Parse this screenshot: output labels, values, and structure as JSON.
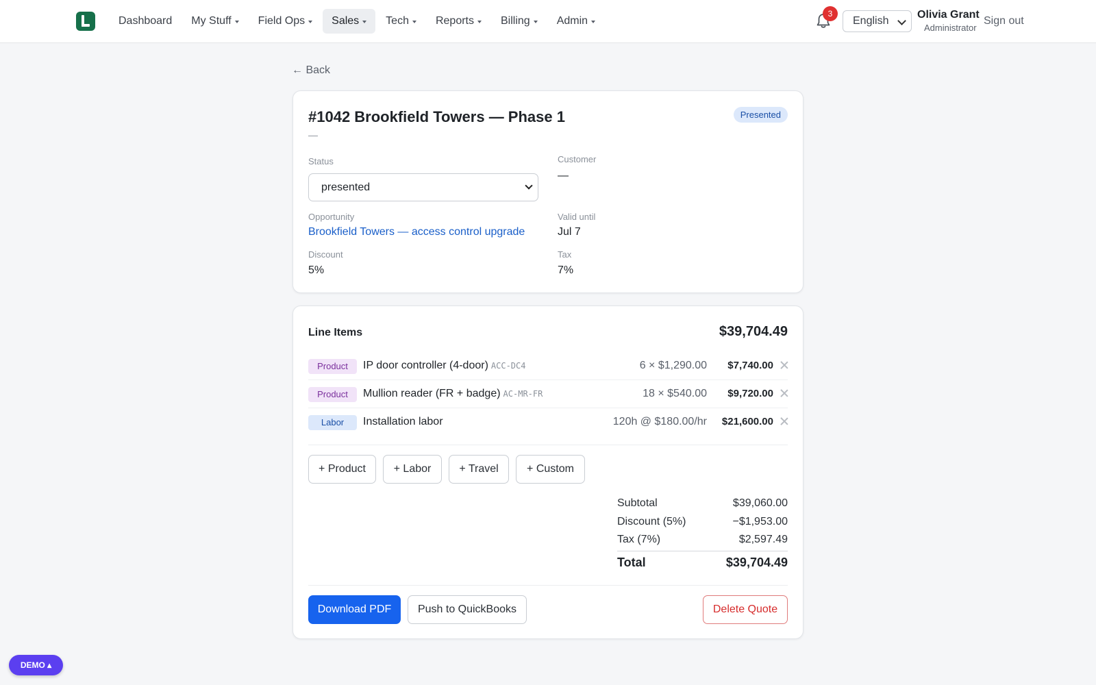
{
  "nav": {
    "items": [
      {
        "label": "Dashboard",
        "dropdown": false,
        "active": false
      },
      {
        "label": "My Stuff",
        "dropdown": true,
        "active": false
      },
      {
        "label": "Field Ops",
        "dropdown": true,
        "active": false
      },
      {
        "label": "Sales",
        "dropdown": true,
        "active": true
      },
      {
        "label": "Tech",
        "dropdown": true,
        "active": false
      },
      {
        "label": "Reports",
        "dropdown": true,
        "active": false
      },
      {
        "label": "Billing",
        "dropdown": true,
        "active": false
      },
      {
        "label": "Admin",
        "dropdown": true,
        "active": false
      }
    ],
    "notifications_count": "3",
    "language": "English",
    "user_name": "Olivia Grant",
    "user_role": "Administrator",
    "signout_label": "Sign out",
    "brand_color": "#16704a"
  },
  "back_label": "← Back",
  "quote": {
    "title": "#1042 Brookfield Towers — Phase 1",
    "subtitle": "—",
    "status_badge": "Presented",
    "status_label": "Status",
    "status_value": "presented",
    "customer_label": "Customer",
    "customer_value": "—",
    "opportunity_label": "Opportunity",
    "opportunity_value": "Brookfield Towers — access control upgrade",
    "valid_until_label": "Valid until",
    "valid_until_value": "Jul 7",
    "discount_label": "Discount",
    "discount_value": "5%",
    "tax_label": "Tax",
    "tax_value": "7%"
  },
  "line_items": {
    "heading": "Line Items",
    "total": "$39,704.49",
    "rows": [
      {
        "type": "Product",
        "name": "IP door controller (4-door)",
        "sku": "ACC-DC4",
        "qty": "6 × $1,290.00",
        "amount": "$7,740.00"
      },
      {
        "type": "Product",
        "name": "Mullion reader (FR + badge)",
        "sku": "AC-MR-FR",
        "qty": "18 × $540.00",
        "amount": "$9,720.00"
      },
      {
        "type": "Labor",
        "name": "Installation labor",
        "sku": "",
        "qty": "120h @ $180.00/hr",
        "amount": "$21,600.00"
      }
    ],
    "add_buttons": [
      "+ Product",
      "+ Labor",
      "+ Travel",
      "+ Custom"
    ]
  },
  "summary": {
    "subtotal_label": "Subtotal",
    "subtotal_value": "$39,060.00",
    "discount_label": "Discount (5%)",
    "discount_value": "−$1,953.00",
    "tax_label": "Tax (7%)",
    "tax_value": "$2,597.49",
    "total_label": "Total",
    "total_value": "$39,704.49"
  },
  "actions": {
    "download_pdf": "Download PDF",
    "push_quickbooks": "Push to QuickBooks",
    "delete_quote": "Delete Quote"
  },
  "demo_label": "DEMO ▴",
  "colors": {
    "primary": "#1763ee",
    "danger": "#d62c2c",
    "demo": "#5b3ff0",
    "link": "#1a5fc9"
  }
}
